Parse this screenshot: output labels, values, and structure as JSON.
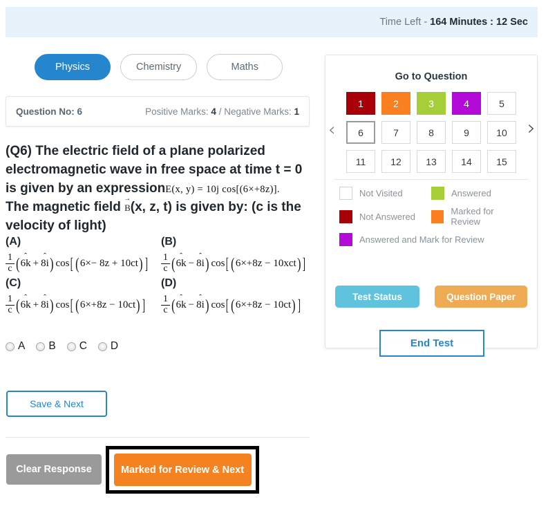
{
  "header": {
    "timer_label": "Time Left -",
    "timer_value": "164 Minutes : 12 Sec"
  },
  "subject_tabs": [
    {
      "label": "Physics",
      "active": true
    },
    {
      "label": "Chemistry",
      "active": false
    },
    {
      "label": "Maths",
      "active": false
    }
  ],
  "question_meta": {
    "question_no_label": "Question No: 6",
    "marks_prefix": "Positive Marks: ",
    "positive_marks": "4",
    "marks_separator": " / Negative Marks: ",
    "negative_marks": "1"
  },
  "question": {
    "line1": "(Q6) The electric field of a plane polarized",
    "line2": "electromagnetic wave in free space at time t = 0",
    "line3_prefix": "is given by an expression",
    "inline_math": "E(x, y) = 10j cos[(6×+8z)].",
    "line4_prefix": "The magnetic field ",
    "vector_symbol": "B",
    "line4_suffix": "(x, z, t) is given by: (c is the",
    "line5": "velocity of light)"
  },
  "options": [
    {
      "letter": "(A)",
      "frac_num": "1",
      "frac_den": "c",
      "coef_first": "6k",
      "sign": "+",
      "coef_second": "8i",
      "cos": "cos",
      "arg": "6×− 8z + 10ct"
    },
    {
      "letter": "(B)",
      "frac_num": "1",
      "frac_den": "c",
      "coef_first": "6k",
      "sign": "−",
      "coef_second": "8i",
      "cos": "cos",
      "arg": "6×+8z − 10xct"
    },
    {
      "letter": "(C)",
      "frac_num": "1",
      "frac_den": "c",
      "coef_first": "6k",
      "sign": "+",
      "coef_second": "8i",
      "cos": "cos",
      "arg": "6×+8z − 10ct"
    },
    {
      "letter": "(D)",
      "frac_num": "1",
      "frac_den": "c",
      "coef_first": "6k",
      "sign": "−",
      "coef_second": "8i",
      "cos": "cos",
      "arg": "6×+8z − 10ct"
    }
  ],
  "answer_choices": [
    {
      "label": "A"
    },
    {
      "label": "B"
    },
    {
      "label": "C"
    },
    {
      "label": "D"
    }
  ],
  "actions": {
    "save_next": "Save & Next",
    "clear_response": "Clear Response",
    "marked_review_next": "Marked for Review & Next"
  },
  "panel": {
    "title": "Go to Question",
    "prev_arrow_icon": "chevron-left-icon",
    "next_arrow_icon": "chevron-right-icon",
    "questions": [
      {
        "n": "1",
        "state": "not-answered",
        "color": "#a80009"
      },
      {
        "n": "2",
        "state": "marked-for-review",
        "color": "#f97f20"
      },
      {
        "n": "3",
        "state": "answered",
        "color": "#a6ce39"
      },
      {
        "n": "4",
        "state": "answered-and-marked",
        "color": "#b30ad9"
      },
      {
        "n": "5",
        "state": "not-visited",
        "color": ""
      },
      {
        "n": "6",
        "state": "current",
        "color": ""
      },
      {
        "n": "7",
        "state": "not-visited",
        "color": ""
      },
      {
        "n": "8",
        "state": "not-visited",
        "color": ""
      },
      {
        "n": "9",
        "state": "not-visited",
        "color": ""
      },
      {
        "n": "10",
        "state": "not-visited",
        "color": ""
      },
      {
        "n": "11",
        "state": "not-visited",
        "color": ""
      },
      {
        "n": "12",
        "state": "not-visited",
        "color": ""
      },
      {
        "n": "13",
        "state": "not-visited",
        "color": ""
      },
      {
        "n": "14",
        "state": "not-visited",
        "color": ""
      },
      {
        "n": "15",
        "state": "not-visited",
        "color": ""
      }
    ],
    "legend": [
      {
        "label": "Not Visited",
        "color": ""
      },
      {
        "label": "Answered",
        "color": "#a6ce39"
      },
      {
        "label": "Not Answered",
        "color": "#a80009"
      },
      {
        "label": "Marked for Review",
        "color": "#f97f20"
      },
      {
        "label": "Answered and Mark for Review",
        "color": "#b30ad9"
      }
    ],
    "test_status_button": "Test Status",
    "question_paper_button": "Question Paper",
    "end_test_button": "End Test"
  }
}
